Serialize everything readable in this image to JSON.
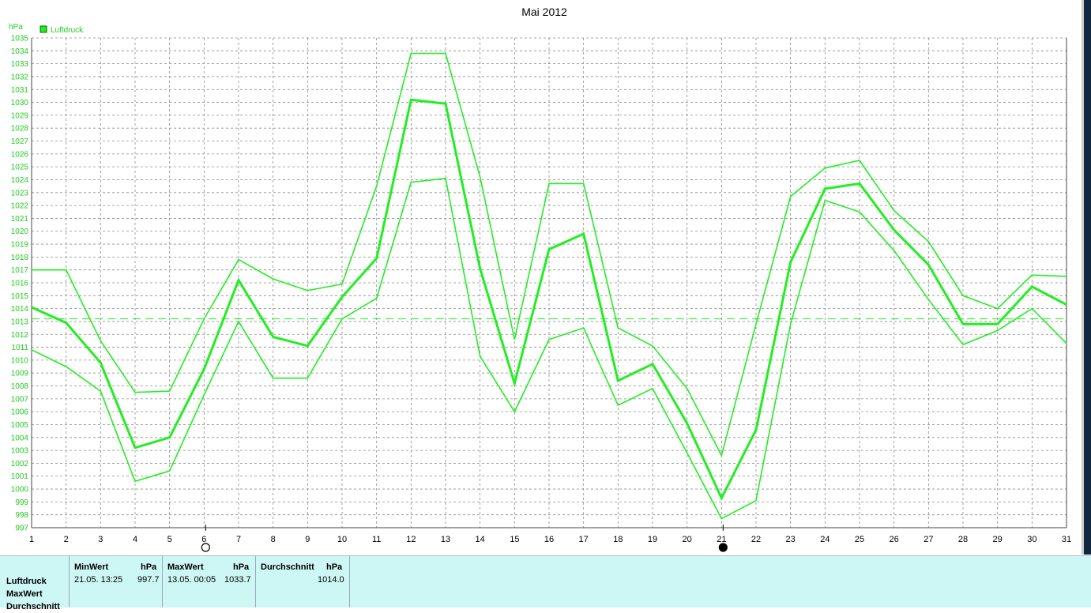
{
  "chart_data": {
    "type": "line",
    "title": "Mai 2012",
    "ylabel": "hPa",
    "legend": "Luftdruck",
    "ylim": [
      997,
      1035
    ],
    "x": [
      1,
      2,
      3,
      4,
      5,
      6,
      7,
      8,
      9,
      10,
      11,
      12,
      13,
      14,
      15,
      16,
      17,
      18,
      19,
      20,
      21,
      22,
      23,
      24,
      25,
      26,
      27,
      28,
      29,
      30,
      31
    ],
    "reference_line": 1013.2,
    "series": [
      {
        "values": [
          1017.0,
          1017.0,
          1011.5,
          1007.5,
          1007.6,
          1013.2,
          1017.8,
          1016.3,
          1015.4,
          1015.9,
          1023.5,
          1033.8,
          1033.8,
          1024.2,
          1011.6,
          1023.7,
          1023.7,
          1012.5,
          1011.1,
          1007.8,
          1002.6,
          1012.8,
          1022.7,
          1024.9,
          1025.5,
          1021.6,
          1019.2,
          1015.0,
          1014.0,
          1016.6,
          1016.5
        ]
      },
      {
        "values": [
          1014.1,
          1012.9,
          1009.8,
          1003.2,
          1004.0,
          1009.3,
          1016.2,
          1011.8,
          1011.1,
          1014.9,
          1017.9,
          1030.2,
          1029.9,
          1017.1,
          1008.2,
          1018.6,
          1019.8,
          1008.4,
          1009.7,
          1005.1,
          999.3,
          1004.6,
          1017.6,
          1023.3,
          1023.7,
          1020.1,
          1017.4,
          1012.8,
          1012.8,
          1015.7,
          1014.3
        ]
      },
      {
        "values": [
          1010.8,
          1009.5,
          1007.6,
          1000.6,
          1001.4,
          1007.3,
          1013.0,
          1008.6,
          1008.6,
          1013.2,
          1014.8,
          1023.8,
          1024.1,
          1010.3,
          1006.0,
          1011.6,
          1012.5,
          1006.5,
          1007.8,
          1002.8,
          997.7,
          999.1,
          1012.8,
          1022.4,
          1021.5,
          1018.5,
          1014.7,
          1011.2,
          1012.3,
          1014.0,
          1011.3
        ]
      }
    ],
    "moon_phases": [
      {
        "day": 6,
        "phase": "full-moon"
      },
      {
        "day": 21,
        "phase": "new-moon"
      }
    ],
    "line_color": "#22ee22",
    "grid": true
  },
  "stats": {
    "row_labels": [
      "Luftdruck",
      "MaxWert",
      "Durchschnitt"
    ],
    "min": {
      "header": "MinWert",
      "unit": "hPa",
      "datetime": "21.05.  13:25",
      "value": "997.7"
    },
    "max": {
      "header": "MaxWert",
      "unit": "hPa",
      "datetime": "13.05.  00:05",
      "value": "1033.7"
    },
    "avg": {
      "header": "Durchschnitt",
      "unit": "hPa",
      "value": "1014.0"
    }
  }
}
